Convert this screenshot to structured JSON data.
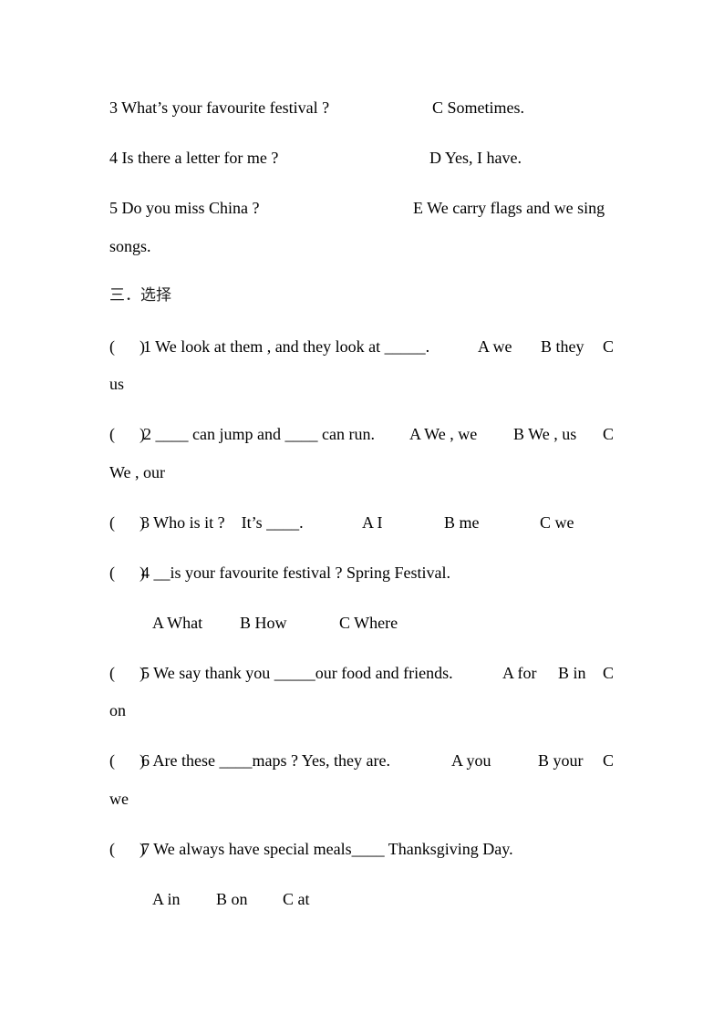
{
  "matching": {
    "items": [
      {
        "question": "3 What’s your favourite festival ?",
        "answer": "C Sometimes."
      },
      {
        "question": "4 Is there a letter for me ?",
        "answer": "D Yes, I have."
      },
      {
        "question": "5 Do you miss China ?",
        "answer": "E We carry flags and we sing",
        "answer_cont": "songs."
      }
    ]
  },
  "section3": {
    "heading": "三．选择",
    "questions": [
      {
        "bracket": "(      )",
        "stem": "1 We look at them , and they look at _____.",
        "options": [
          "A we",
          "B they",
          "C"
        ],
        "cont": "us"
      },
      {
        "bracket": "(      )",
        "stem": "2 ____ can jump and ____ can run.",
        "options": [
          "A We , we",
          "B We , us",
          "C"
        ],
        "cont": "We , our"
      },
      {
        "bracket": "(      )",
        "stem": "3 Who is it ?    It’s ____.",
        "options": [
          "A I",
          "B me",
          "C we"
        ]
      },
      {
        "bracket": "(      )",
        "stem": "4 __is your favourite festival ? Spring Festival.",
        "options": [
          "A What",
          "B How",
          "C Where"
        ]
      },
      {
        "bracket": "(      )",
        "stem": "5 We say thank you _____our food and friends.",
        "options": [
          "A for",
          "B in",
          "C"
        ],
        "cont": "on"
      },
      {
        "bracket": "(      )",
        "stem": "6 Are these ____maps ? Yes, they are.",
        "options": [
          "A you",
          "B your",
          "C"
        ],
        "cont": "we"
      },
      {
        "bracket": "(      )",
        "stem": "7 We always have special meals____ Thanksgiving Day.",
        "options": [
          "A in",
          "B on",
          "C at"
        ]
      }
    ]
  }
}
